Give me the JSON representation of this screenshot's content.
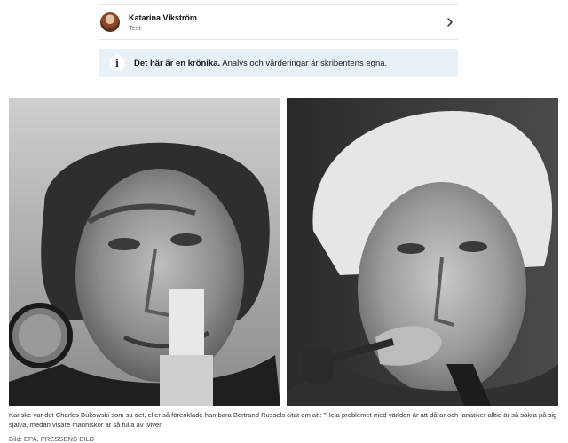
{
  "author": {
    "name": "Katarina Vikström",
    "role": "Text",
    "chevron_icon": "chevron-right-icon"
  },
  "notice": {
    "icon": "info-icon",
    "icon_glyph": "i",
    "bold": "Det här är en krönika.",
    "text": " Analys och värderingar är skribentens egna."
  },
  "images": {
    "left_subject": "Charles Bukowski",
    "right_subject": "Bertrand Russell"
  },
  "caption": {
    "text": "Kanske var det Charles Bukowski som sa det, eller så förenklade han bara Bertrand Russels citat om att: \"Hela problemet med världen är att dårar och fanatiker alltid är så säkra på sig själva, medan visare människor är så fulla av tvivel\"",
    "credit": "Bild: EPA, PRESSENS BILD"
  }
}
